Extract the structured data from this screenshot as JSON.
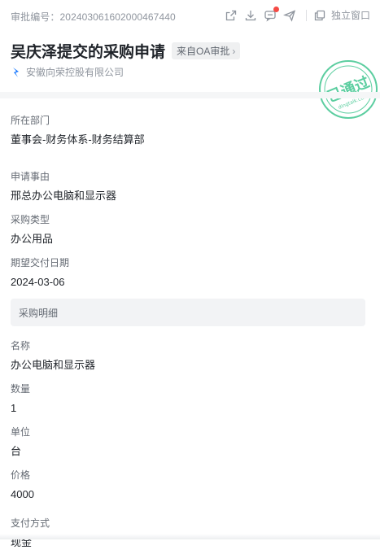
{
  "header": {
    "serial_label": "审批编号：",
    "serial_number": "202403061602000467440",
    "standalone_label": "独立窗口",
    "icons": [
      "share-icon",
      "download-icon",
      "comment-icon",
      "send-icon",
      "window-icon"
    ]
  },
  "title": {
    "text": "吴庆泽提交的采购申请",
    "source_tag": "来自OA审批",
    "source_chevron": "›"
  },
  "company": {
    "name": "安徽向荣控股有限公司"
  },
  "stamp": {
    "text": "已通过",
    "subtext": "dingtalk.com",
    "color": "#5ccea0"
  },
  "fields": [
    {
      "label": "所在部门",
      "value": "董事会-财务体系-财务结算部"
    },
    {
      "label": "申请事由",
      "value": "邢总办公电脑和显示器"
    },
    {
      "label": "采购类型",
      "value": "办公用品"
    },
    {
      "label": "期望交付日期",
      "value": "2024-03-06"
    }
  ],
  "detail_group": {
    "title": "采购明细"
  },
  "detail_fields": [
    {
      "label": "名称",
      "value": "办公电脑和显示器"
    },
    {
      "label": "数量",
      "value": "1"
    },
    {
      "label": "单位",
      "value": "台"
    },
    {
      "label": "价格",
      "value": "4000"
    }
  ],
  "payment": {
    "label": "支付方式",
    "value": "现金"
  },
  "colors": {
    "accent": "#1677ff",
    "stamp": "#5ccea0",
    "notify_dot": "#f54a45"
  }
}
